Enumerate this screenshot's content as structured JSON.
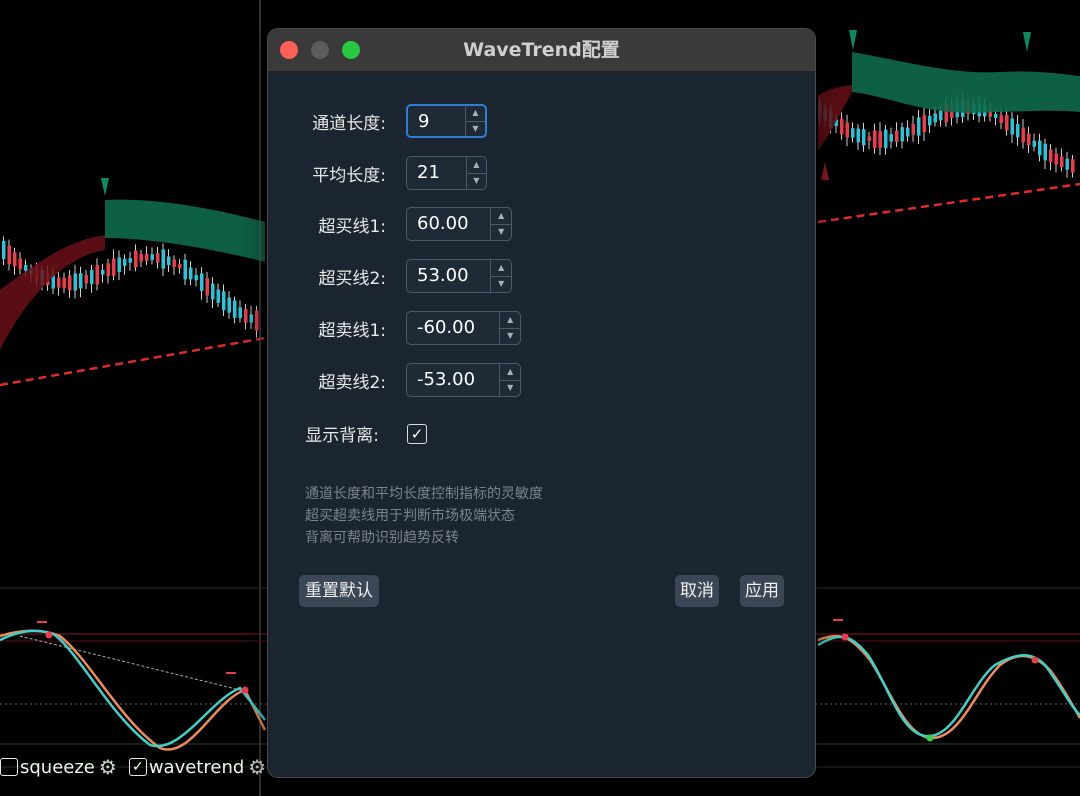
{
  "dialog": {
    "title": "WaveTrend配置",
    "fields": [
      {
        "label": "通道长度:",
        "value": "9"
      },
      {
        "label": "平均长度:",
        "value": "21"
      },
      {
        "label": "超买线1:",
        "value": "60.00"
      },
      {
        "label": "超买线2:",
        "value": "53.00"
      },
      {
        "label": "超卖线1:",
        "value": "-60.00"
      },
      {
        "label": "超卖线2:",
        "value": "-53.00"
      }
    ],
    "divergence": {
      "label": "显示背离:",
      "checked": true,
      "mark": "✓"
    },
    "help_lines": [
      "通道长度和平均长度控制指标的灵敏度",
      "超买超卖线用于判断市场极端状态",
      "背离可帮助识别趋势反转"
    ],
    "buttons": {
      "reset": "重置默认",
      "cancel": "取消",
      "apply": "应用"
    }
  },
  "indicator_bar": {
    "items": [
      {
        "label": "squeeze",
        "checked": false,
        "mark": ""
      },
      {
        "label": "wavetrend",
        "checked": true,
        "mark": "✓"
      }
    ],
    "gear_icon": "⚙"
  },
  "colors": {
    "bull": "#26c6da",
    "bear": "#ef3b4c",
    "cloud_green": "#0f6a4c",
    "cloud_red": "#6a1016",
    "support_line": "#e02a2a",
    "wt1": "#3fd1c8",
    "wt2": "#f08a5a"
  }
}
